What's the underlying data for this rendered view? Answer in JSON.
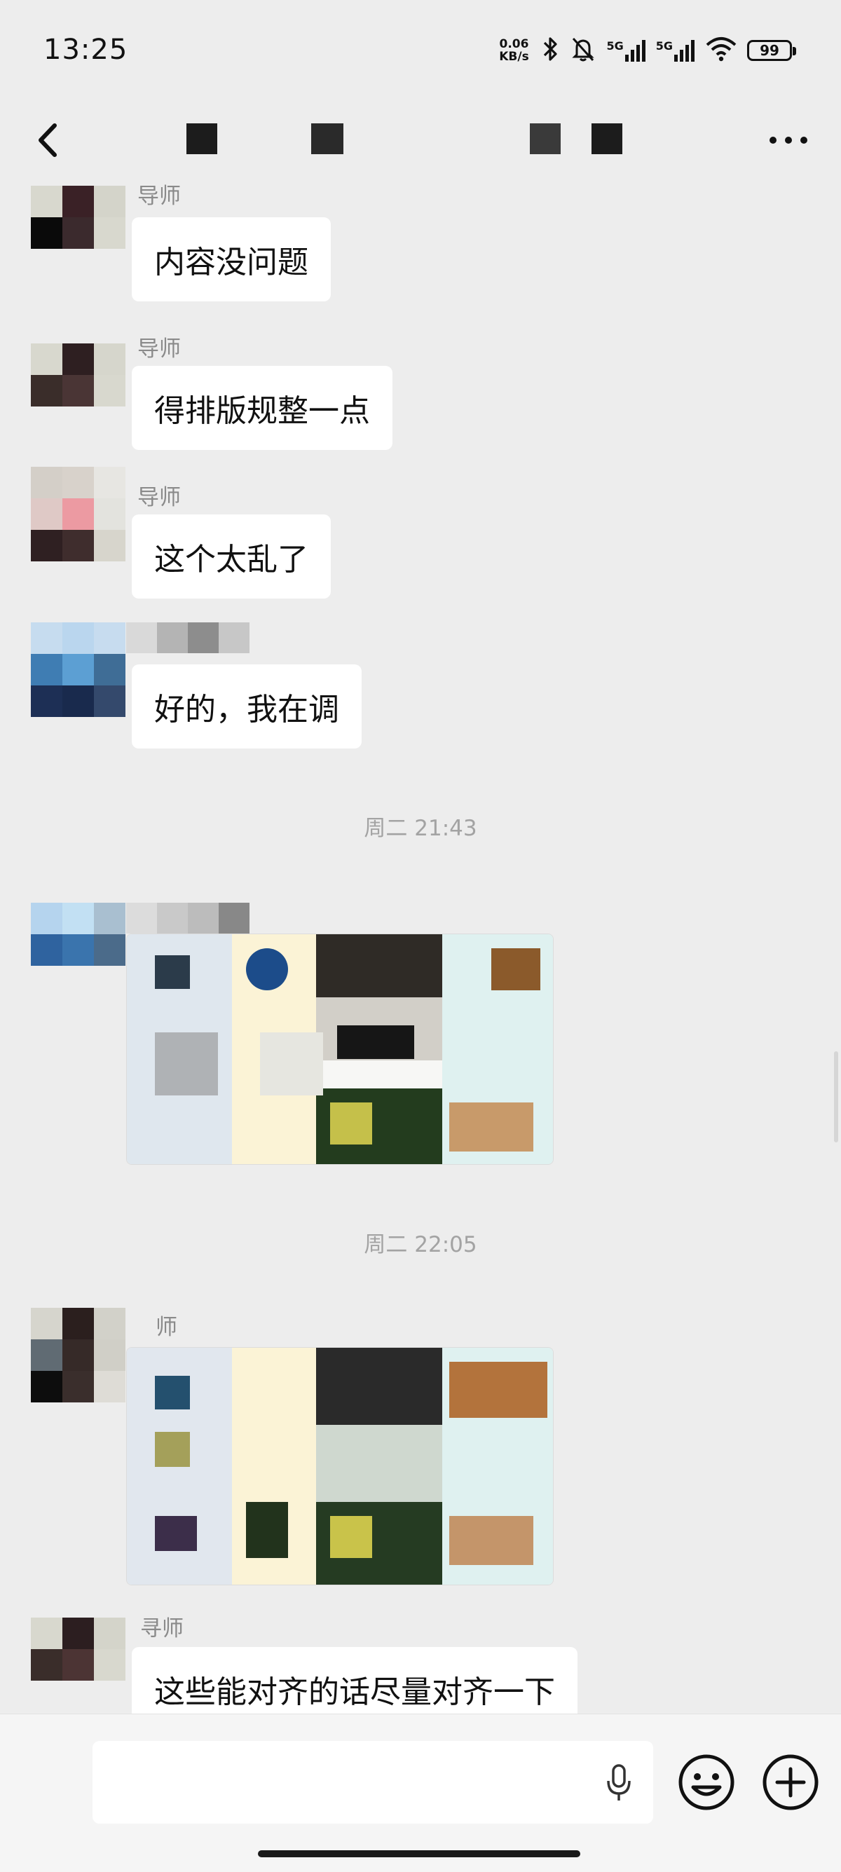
{
  "status_bar": {
    "time": "13:25",
    "net_speed_value": "0.06",
    "net_speed_unit": "KB/s",
    "sim1_label": "5G",
    "sim2_label": "5G",
    "battery": "99"
  },
  "nav": {
    "back_icon": "back-chevron-icon",
    "more_icon": "more-dots-icon"
  },
  "messages": [
    {
      "sender": "导师",
      "text": "内容没问题"
    },
    {
      "sender": "导师",
      "text": "得排版规整一点"
    },
    {
      "sender": "导师",
      "text": "这个太乱了"
    },
    {
      "sender": "",
      "text": "好的，我在调"
    }
  ],
  "timestamps": [
    "周二 21:43",
    "周二 22:05"
  ],
  "image_messages": [
    {
      "sender": "",
      "kind": "image"
    },
    {
      "sender": "师",
      "kind": "image"
    }
  ],
  "last_message": {
    "sender": "寻师",
    "text": "这些能对齐的话尽量对齐一下"
  },
  "input_bar": {
    "placeholder": "",
    "mic_icon": "microphone-icon",
    "emoji_icon": "emoji-smile-icon",
    "plus_icon": "plus-circle-icon"
  },
  "colors": {
    "background": "#ededed",
    "bubble": "#ffffff",
    "meta_text": "#8a8a8a"
  }
}
